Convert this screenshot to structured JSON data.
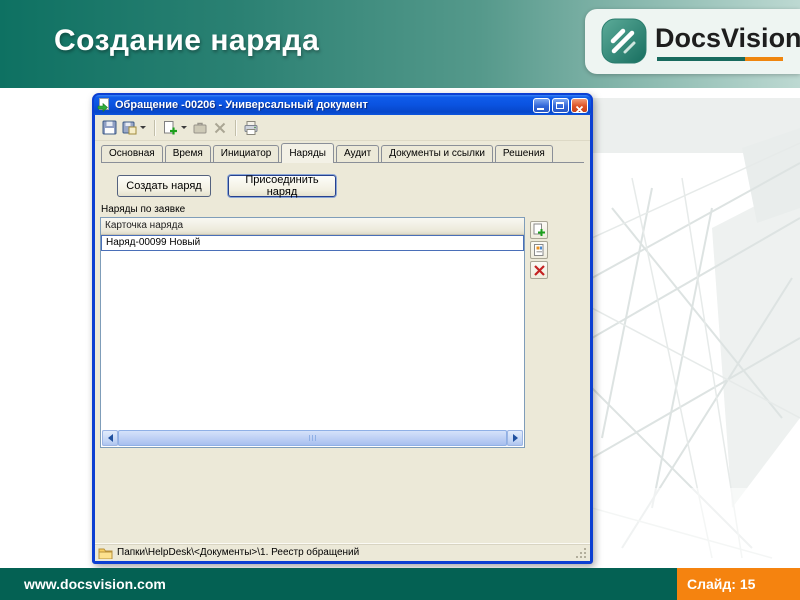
{
  "header": {
    "title": "Создание наряда",
    "gradient_left": "#0e7162",
    "gradient_right": "#bdd9d2"
  },
  "logo": {
    "name": "DocsVision",
    "underline_teal": "#186a5e",
    "underline_orange": "#ef850e"
  },
  "window": {
    "title": "Обращение -00206 - Универсальный документ",
    "tabs": [
      {
        "label": "Основная"
      },
      {
        "label": "Время"
      },
      {
        "label": "Инициатор"
      },
      {
        "label": "Наряды"
      },
      {
        "label": "Аудит"
      },
      {
        "label": "Документы и ссылки"
      },
      {
        "label": "Решения"
      }
    ],
    "active_tab": "Наряды",
    "actions": {
      "create": "Создать наряд",
      "attach": "Присоединить наряд"
    },
    "list": {
      "label": "Наряды по заявке",
      "column_header": "Карточка наряда",
      "rows": [
        "Наряд-00099 Новый"
      ]
    },
    "status_path": "Папки\\HelpDesk\\<Документы>\\1. Реестр обращений"
  },
  "footer": {
    "url": "www.docsvision.com",
    "slide_label": "Слайд: 15",
    "bar_color": "#046153",
    "accent_color": "#f5830f"
  },
  "colors": {
    "titlebar_blue": "#0b54e2",
    "window_border_blue": "#0c3fd2",
    "client_beige": "#ece9d8",
    "selection_outline_blue": "#4a6fb8",
    "close_button_red": "#dd5226",
    "scrollbar_blue": "#bacdf4"
  },
  "icons": {
    "titlebar": "document-arrow-icon",
    "toolbar": [
      "save-icon",
      "save-close-icon",
      "new-order-icon",
      "briefcase-icon",
      "delete-icon",
      "print-icon"
    ],
    "list_buttons": [
      "add-row-icon",
      "properties-row-icon",
      "delete-row-icon"
    ],
    "statusbar": "folder-icon"
  }
}
